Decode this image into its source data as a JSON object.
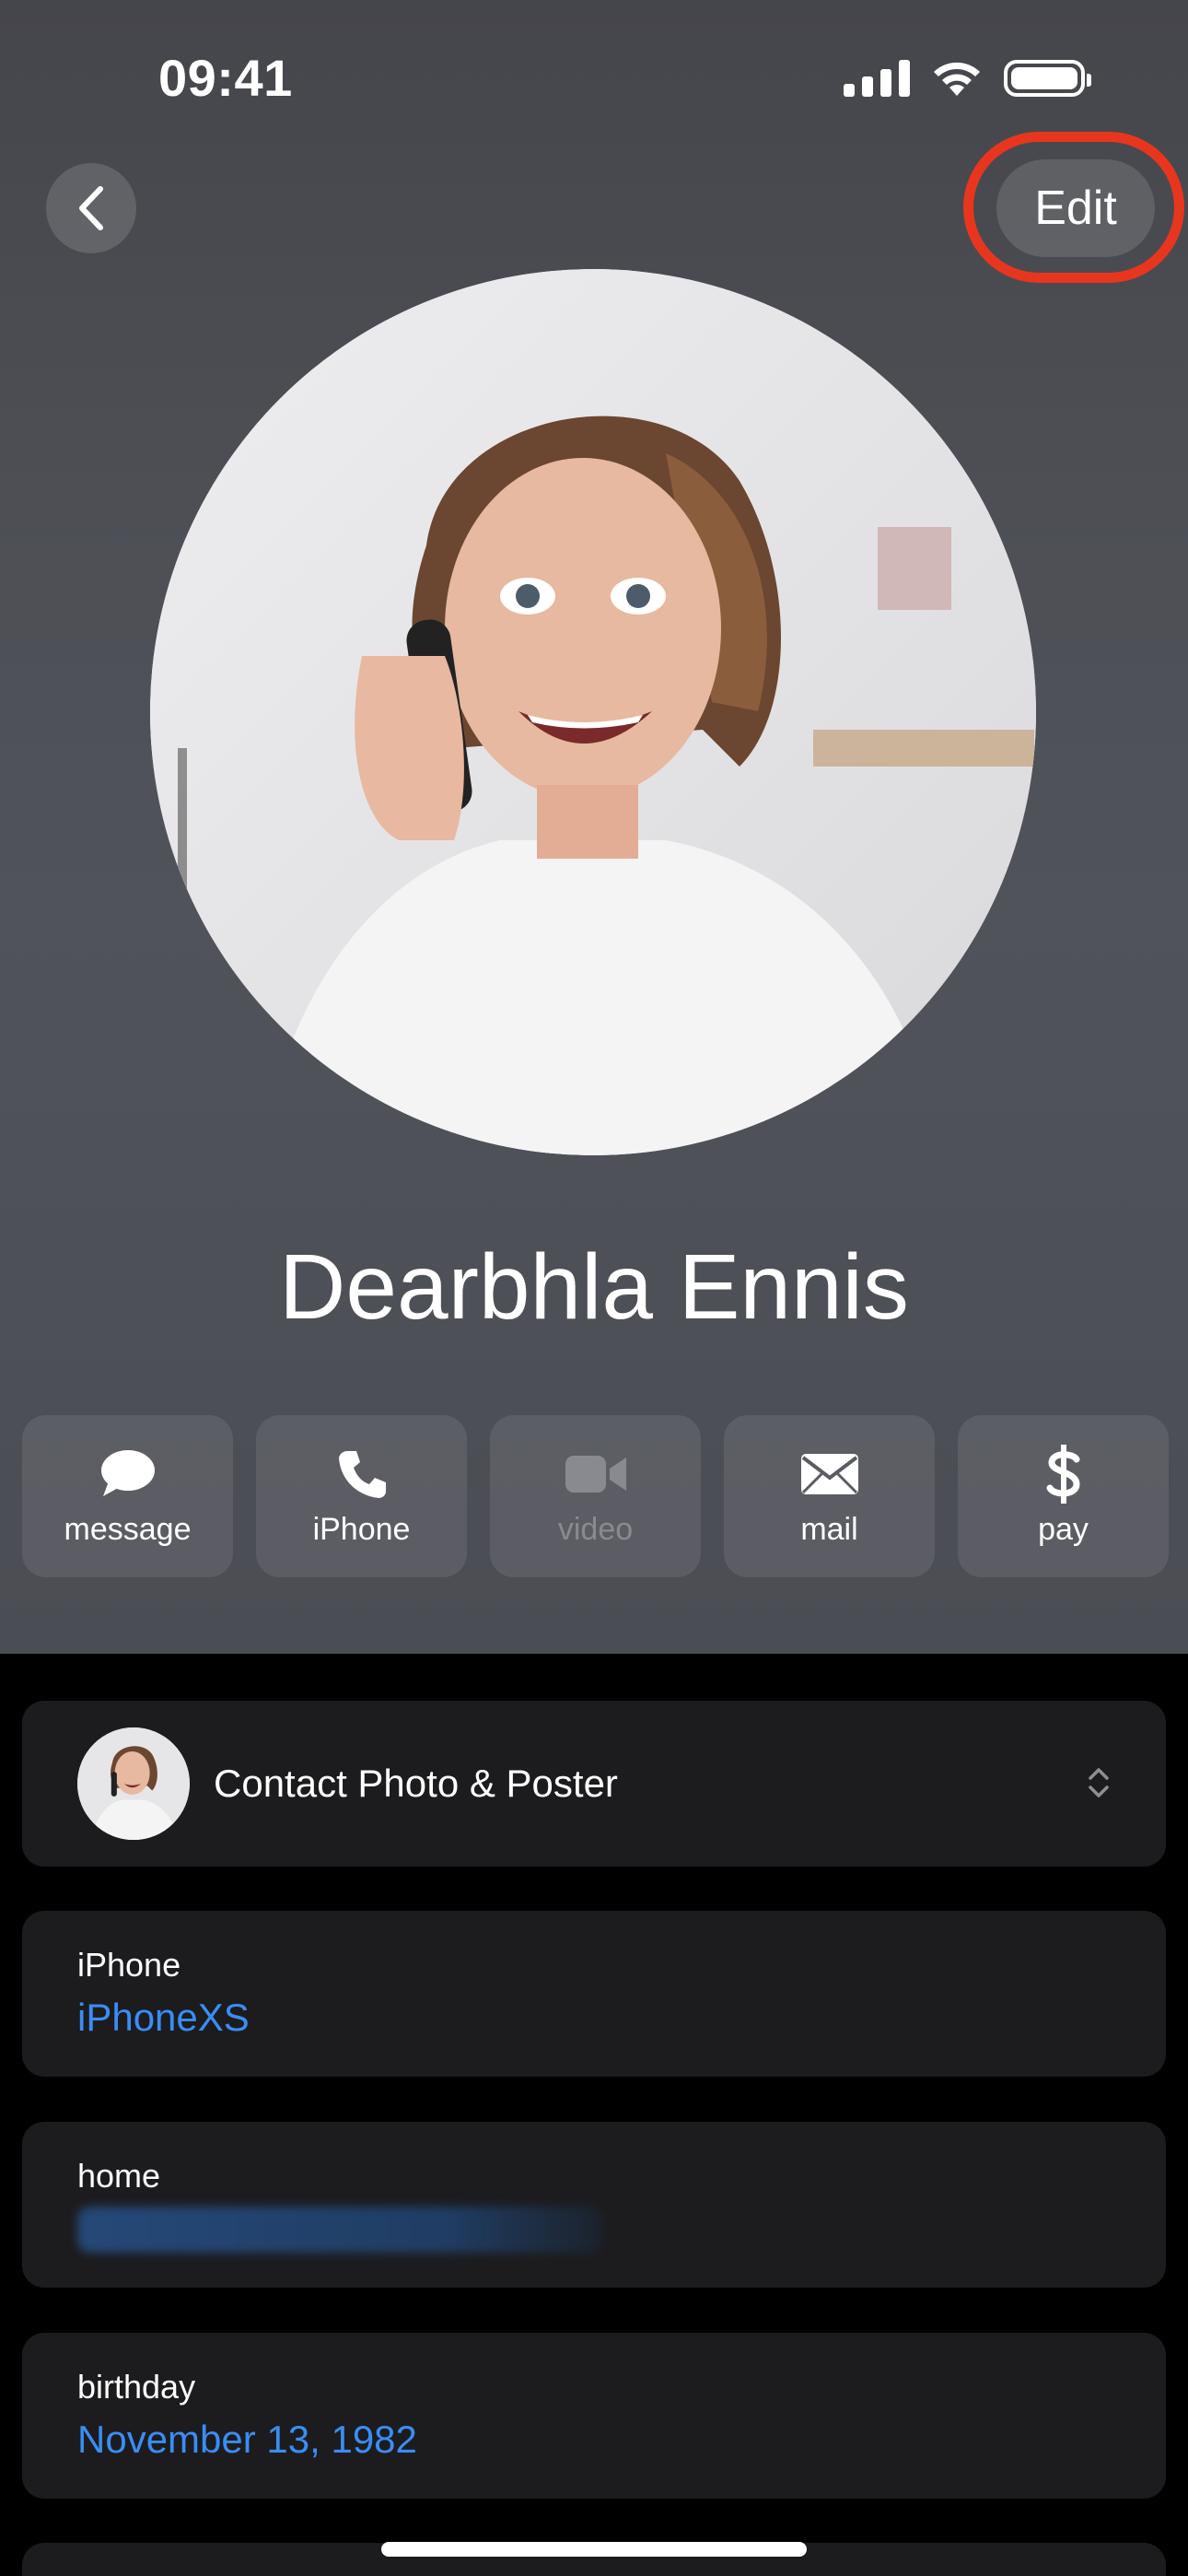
{
  "status_bar": {
    "time": "09:41"
  },
  "nav": {
    "edit_label": "Edit"
  },
  "contact": {
    "name": "Dearbhla Ennis"
  },
  "actions": [
    {
      "label": "message",
      "icon": "message-bubble-icon",
      "enabled": true
    },
    {
      "label": "iPhone",
      "icon": "phone-icon",
      "enabled": true
    },
    {
      "label": "video",
      "icon": "video-camera-icon",
      "enabled": false
    },
    {
      "label": "mail",
      "icon": "envelope-icon",
      "enabled": true
    },
    {
      "label": "pay",
      "icon": "dollar-icon",
      "enabled": true
    }
  ],
  "poster_card": {
    "label": "Contact Photo & Poster"
  },
  "fields": {
    "iphone": {
      "label": "iPhone",
      "value": "iPhoneXS"
    },
    "home": {
      "label": "home"
    },
    "birthday": {
      "label": "birthday",
      "value": "November 13, 1982"
    }
  },
  "colors": {
    "accent": "#3a8df5",
    "highlight": "#e8361e",
    "card_background": "#1c1c1e",
    "header_background": "#4b4d53"
  }
}
